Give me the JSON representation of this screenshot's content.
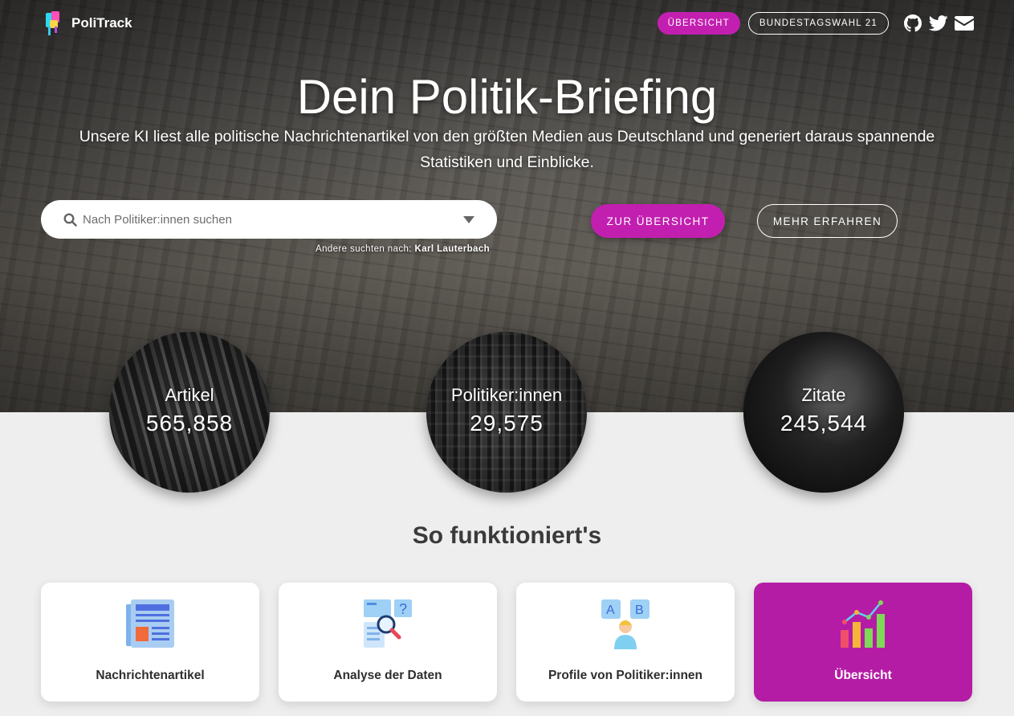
{
  "brand": {
    "name": "PoliTrack"
  },
  "nav": {
    "overview_label": "ÜBERSICHT",
    "election_label": "BUNDESTAGSWAHL 21",
    "icons": [
      "github-icon",
      "twitter-icon",
      "envelope-icon"
    ]
  },
  "hero": {
    "title": "Dein Politik-Briefing",
    "subtitle": "Unsere KI liest alle politische Nachrichtenartikel von den größten Medien aus Deutschland und generiert daraus spannende Statistiken und Einblicke."
  },
  "search": {
    "placeholder": "Nach Politiker:innen suchen",
    "value": "",
    "suggest_prefix": "Andere suchten nach:",
    "suggest_name": "Karl Lauterbach"
  },
  "cta": {
    "primary_label": "ZUR ÜBERSICHT",
    "secondary_label": "MEHR ERFAHREN"
  },
  "stats": [
    {
      "label": "Artikel",
      "value": "565,858"
    },
    {
      "label": "Politiker:innen",
      "value": "29,575"
    },
    {
      "label": "Zitate",
      "value": "245,544"
    }
  ],
  "how": {
    "title": "So funktioniert's",
    "cards": [
      {
        "label": "Nachrichtenartikel",
        "icon": "newspaper-icon"
      },
      {
        "label": "Analyse der Daten",
        "icon": "data-analysis-icon"
      },
      {
        "label": "Profile von Politiker:innen",
        "icon": "politician-profile-icon"
      },
      {
        "label": "Übersicht",
        "icon": "bar-chart-icon",
        "active": true
      }
    ]
  },
  "colors": {
    "accent": "#c21fb0",
    "background": "#eeeeee",
    "text": "#2e2e2e"
  }
}
